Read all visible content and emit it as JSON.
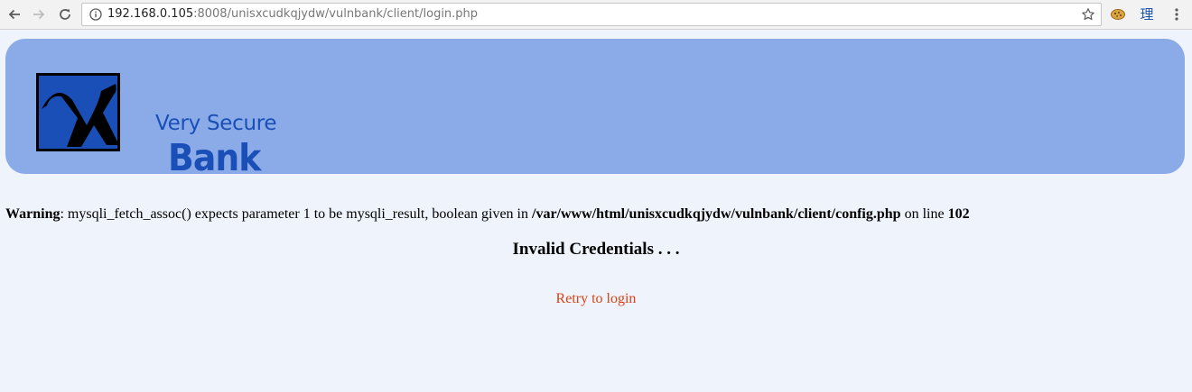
{
  "browser": {
    "url_host": "192.168.0.105",
    "url_rest": ":8008/unisxcudkqjydw/vulnbank/client/login.php",
    "extension_icons": [
      "cookie-icon",
      "kanji-extension-icon"
    ],
    "extension_kanji": "理"
  },
  "banner": {
    "logo_line1": "Very Secure",
    "logo_line2": "Bank",
    "logo_color": "#1a4fb7",
    "background_color": "#8aabe8"
  },
  "warning": {
    "label": "Warning",
    "message": ": mysqli_fetch_assoc() expects parameter 1 to be mysqli_result, boolean given in ",
    "path": "/var/www/html/unisxcudkqjydw/vulnbank/client/config.php",
    "line_text": " on line ",
    "line_number": "102"
  },
  "main": {
    "heading": "Invalid Credentials . . .",
    "retry_link": "Retry to login",
    "link_color": "#d84315"
  }
}
